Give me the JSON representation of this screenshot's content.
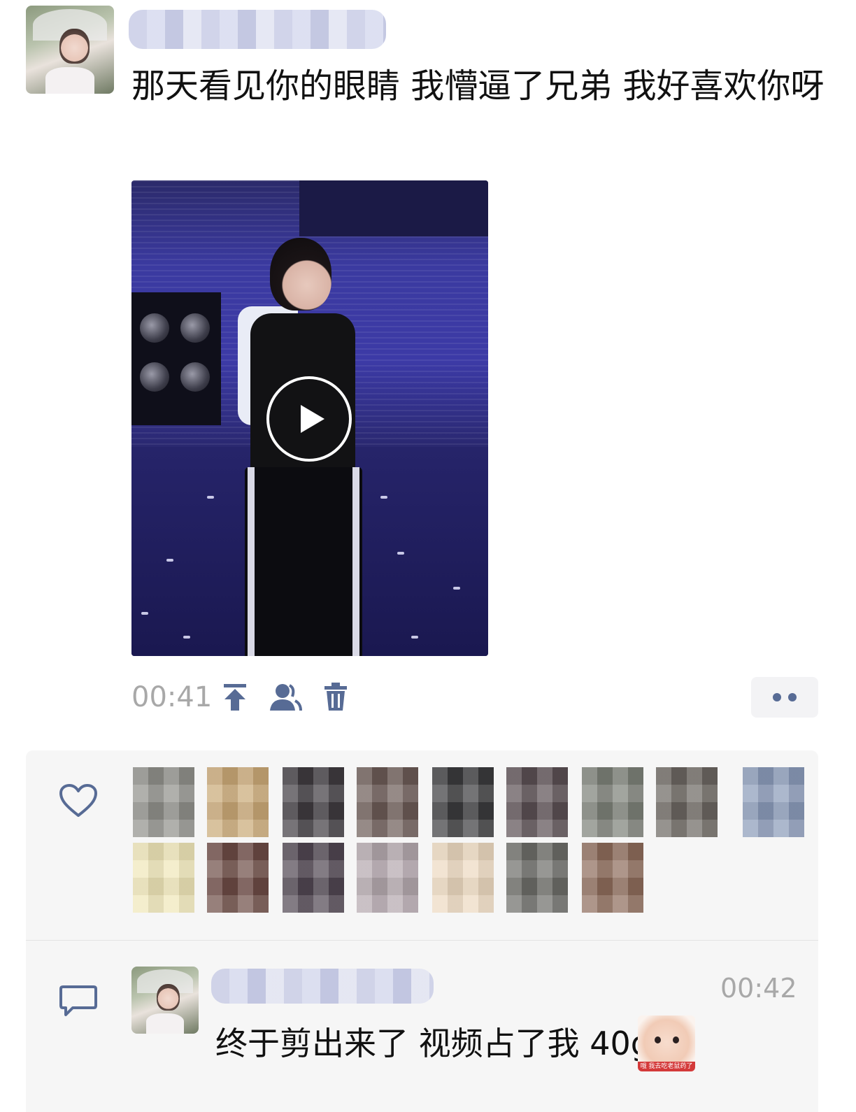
{
  "post": {
    "text": "那天看见你的眼睛 我懵逼了兄弟 我好喜欢你呀",
    "time": "00:41"
  },
  "icons": {
    "pin": "pin-top-icon",
    "visibility": "people-icon",
    "delete": "trash-icon",
    "more": "more-dots-icon",
    "like": "heart-icon",
    "comment": "comment-bubble-icon",
    "play": "play-icon"
  },
  "colors": {
    "link_blue": "#576b95",
    "time_gray": "#a8a8a8",
    "panel_bg": "#f6f6f6"
  },
  "likes": {
    "count_shown": 17
  },
  "comment": {
    "text": "终于剪出来了 视频占了我 40g",
    "time": "00:42",
    "sticker_caption": "哦 我去吃老鼠药了"
  }
}
